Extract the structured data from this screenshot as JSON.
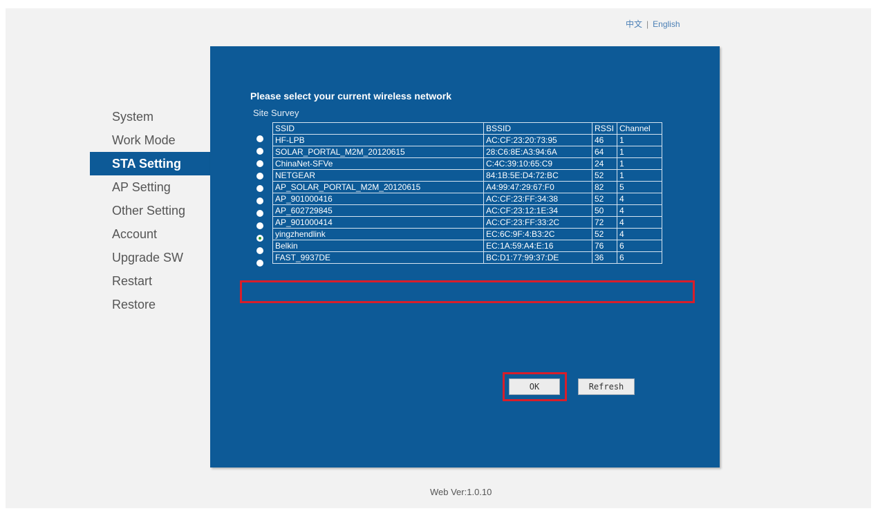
{
  "lang": {
    "chinese": "中文",
    "separator": "|",
    "english": "English"
  },
  "sidebar": {
    "items": [
      {
        "label": "System"
      },
      {
        "label": "Work Mode"
      },
      {
        "label": "STA Setting"
      },
      {
        "label": "AP Setting"
      },
      {
        "label": "Other Setting"
      },
      {
        "label": "Account"
      },
      {
        "label": "Upgrade SW"
      },
      {
        "label": "Restart"
      },
      {
        "label": "Restore"
      }
    ],
    "active": "STA Setting"
  },
  "main": {
    "heading": "Please select your current wireless network",
    "survey_label": "Site Survey",
    "columns": [
      "SSID",
      "BSSID",
      "RSSI",
      "Channel"
    ],
    "networks": [
      {
        "ssid": "HF-LPB",
        "bssid": "AC:CF:23:20:73:95",
        "rssi": "46",
        "channel": "1"
      },
      {
        "ssid": "SOLAR_PORTAL_M2M_20120615",
        "bssid": "28:C6:8E:A3:94:6A",
        "rssi": "64",
        "channel": "1"
      },
      {
        "ssid": "ChinaNet-SFVe",
        "bssid": "C:4C:39:10:65:C9",
        "rssi": "24",
        "channel": "1"
      },
      {
        "ssid": "NETGEAR",
        "bssid": "84:1B:5E:D4:72:BC",
        "rssi": "52",
        "channel": "1"
      },
      {
        "ssid": "AP_SOLAR_PORTAL_M2M_20120615",
        "bssid": "A4:99:47:29:67:F0",
        "rssi": "82",
        "channel": "5"
      },
      {
        "ssid": "AP_901000416",
        "bssid": "AC:CF:23:FF:34:38",
        "rssi": "52",
        "channel": "4"
      },
      {
        "ssid": "AP_602729845",
        "bssid": "AC:CF:23:12:1E:34",
        "rssi": "50",
        "channel": "4"
      },
      {
        "ssid": "AP_901000414",
        "bssid": "AC:CF:23:FF:33:2C",
        "rssi": "72",
        "channel": "4"
      },
      {
        "ssid": "yingzhendlink",
        "bssid": "EC:6C:9F:4:B3:2C",
        "rssi": "52",
        "channel": "4"
      },
      {
        "ssid": "Belkin",
        "bssid": "EC:1A:59:A4:E:16",
        "rssi": "76",
        "channel": "6"
      },
      {
        "ssid": "FAST_9937DE",
        "bssid": "BC:D1:77:99:37:DE",
        "rssi": "36",
        "channel": "6"
      }
    ],
    "selected_ssid": "yingzhendlink",
    "ok_label": "OK",
    "refresh_label": "Refresh"
  },
  "footer": {
    "version": "Web Ver:1.0.10"
  },
  "colors": {
    "panel": "#0d5a97",
    "highlight": "#d81e2a",
    "radio_check": "#2d9a2d"
  }
}
